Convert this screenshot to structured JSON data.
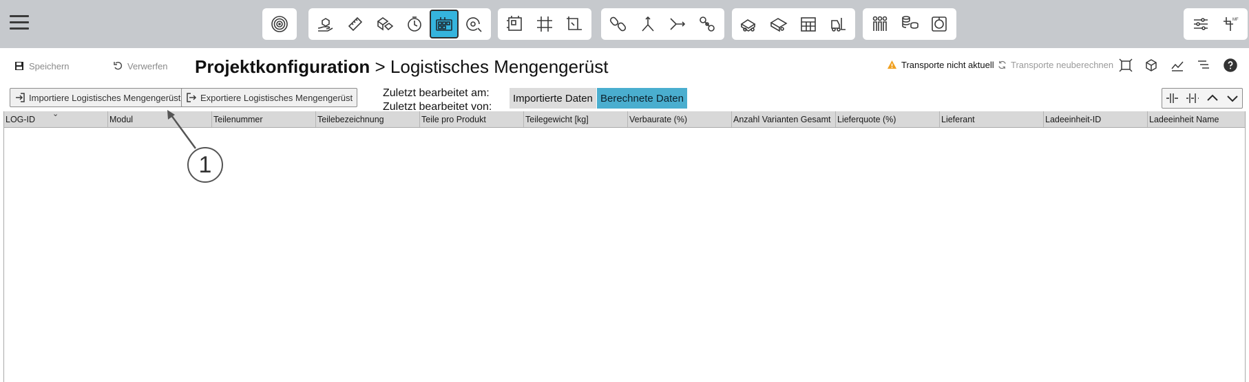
{
  "toolbar": {
    "menu_icon": "hamburger-menu-icon",
    "groups": [
      [
        "radar-icon"
      ],
      [
        "hand-box-icon",
        "ruler-icon",
        "boxes-icon",
        "clock-icon",
        "box-grid-icon",
        "search-circle-icon"
      ],
      [
        "layout-frame-icon",
        "grid-hash-icon",
        "layout-corner-icon"
      ],
      [
        "chain-icon",
        "split-arrows-icon",
        "merge-arrows-icon",
        "chain-links-icon"
      ],
      [
        "truck-box-icon",
        "truck-open-icon",
        "shelf-icon",
        "forklift-icon"
      ],
      [
        "people-icon",
        "stacked-coins-icon",
        "target-box-icon"
      ],
      [
        "settings-sliders-icon",
        "mf-layout-icon"
      ]
    ],
    "active_icon": "box-grid-icon",
    "accent_color": "#35b4dd"
  },
  "header": {
    "save_label": "Speichern",
    "discard_label": "Verwerfen",
    "title_main": "Projektkonfiguration",
    "title_sep": ">",
    "title_sub": "Logistisches Mengengerüst",
    "warning_text": "Transporte nicht aktuell",
    "recalc_label": "Transporte neuberechnen"
  },
  "actions": {
    "import_label": "Importiere Logistisches Mengengerüst",
    "export_label": "Exportiere Logistisches Mengengerüst",
    "edited_at_label": "Zuletzt bearbeitet am:",
    "edited_by_label": "Zuletzt bearbeitet von:",
    "imported_data_label": "Importierte Daten",
    "calculated_data_label": "Berechnete Daten"
  },
  "grid": {
    "columns": [
      "LOG-ID",
      "Modul",
      "Teilenummer",
      "Teilebezeichnung",
      "Teile pro Produkt",
      "Teilegewicht [kg]",
      "Verbaurate (%)",
      "Anzahl Varianten Gesamt",
      "Lieferquote (%)",
      "Lieferant",
      "Ladeeinheit-ID",
      "Ladeeinheit Name"
    ],
    "rows": []
  },
  "callout": {
    "number": "1"
  }
}
